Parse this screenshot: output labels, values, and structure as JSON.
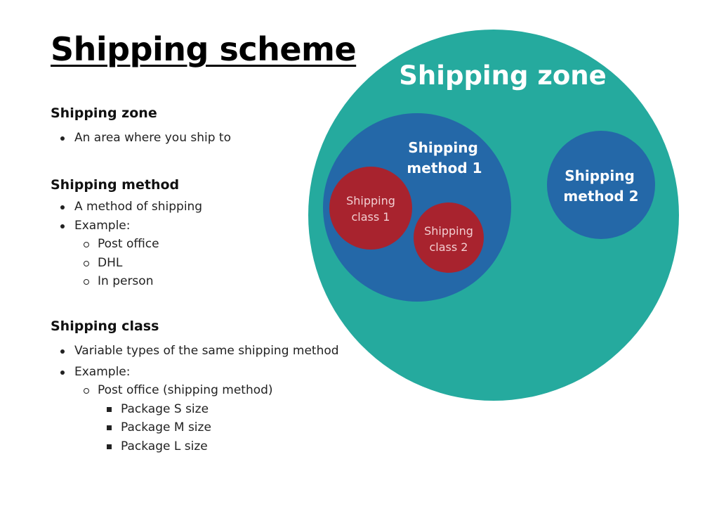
{
  "title": "Shipping scheme",
  "sections": {
    "zone": {
      "heading": "Shipping zone",
      "items": [
        "An area where you ship to"
      ]
    },
    "method": {
      "heading": "Shipping method",
      "items": [
        "A method of shipping",
        "Example:"
      ],
      "examples": [
        "Post office",
        "DHL",
        "In person"
      ]
    },
    "class": {
      "heading": "Shipping class",
      "items": [
        "Variable types of the same shipping method",
        "Example:"
      ],
      "example": "Post office (shipping method)",
      "sizes": [
        "Package S size",
        "Package M size",
        "Package L size"
      ]
    }
  },
  "diagram": {
    "zone": {
      "label": "Shipping zone",
      "color": "#25aa9e"
    },
    "method1": {
      "label_line1": "Shipping",
      "label_line2": "method 1",
      "color": "#2468a8"
    },
    "method2": {
      "label_line1": "Shipping",
      "label_line2": "method 2",
      "color": "#2468a8"
    },
    "class1": {
      "label_line1": "Shipping",
      "label_line2": "class 1",
      "color": "#a8232e"
    },
    "class2": {
      "label_line1": "Shipping",
      "label_line2": "class 2",
      "color": "#a8232e"
    },
    "label_color": "#ffffff",
    "class_label_color": "#f2cfd2"
  }
}
